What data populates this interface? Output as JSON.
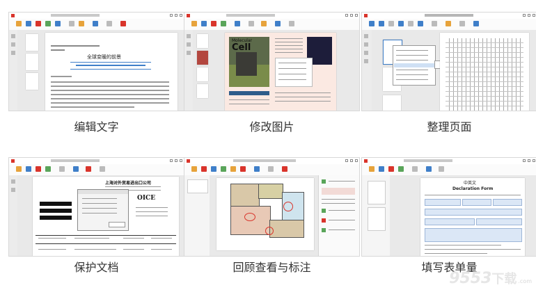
{
  "features": [
    {
      "caption": "编辑文字",
      "doc_title": "全球变暖的前景"
    },
    {
      "caption": "修改图片",
      "cover_title": "Molecular",
      "cover_big": "Cell"
    },
    {
      "caption": "整理页面"
    },
    {
      "caption": "保护文档",
      "company": "上海对外贸易进出口公司",
      "doc_word": "OICE"
    },
    {
      "caption": "回顾查看与标注"
    },
    {
      "caption": "填写表单量",
      "form_heading": "中英文",
      "form_title": "Declaration Form"
    }
  ],
  "watermark": {
    "number": "9553",
    "suffix": "下载",
    "domain": ".com"
  },
  "colors": {
    "brand_red": "#d9342b",
    "caption_text": "#333333",
    "ribbon_blue": "#3f7fc9"
  }
}
